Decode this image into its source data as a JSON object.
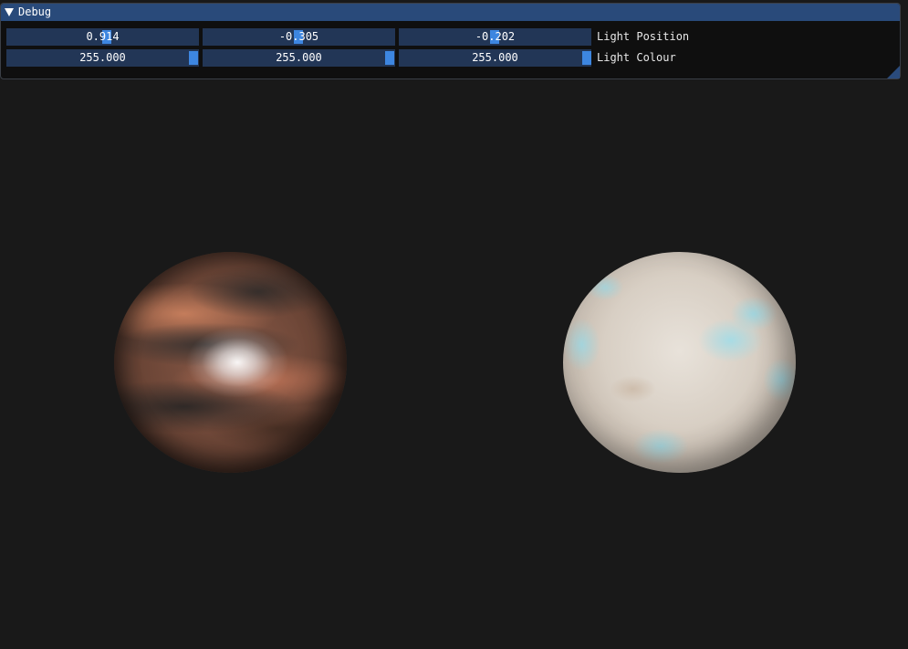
{
  "window": {
    "title": "Debug",
    "collapse_icon": "triangle-down-icon"
  },
  "rows": {
    "light_position": {
      "label": "Light Position",
      "values": [
        "0.914",
        "-0.305",
        "-0.202"
      ]
    },
    "light_colour": {
      "label": "Light Colour",
      "values": [
        "255.000",
        "255.000",
        "255.000"
      ]
    }
  },
  "colors": {
    "title_bar": "#294a7a",
    "slider_bg": "#223656",
    "slider_grab": "#3d86e0",
    "viewport_bg": "#191919"
  }
}
